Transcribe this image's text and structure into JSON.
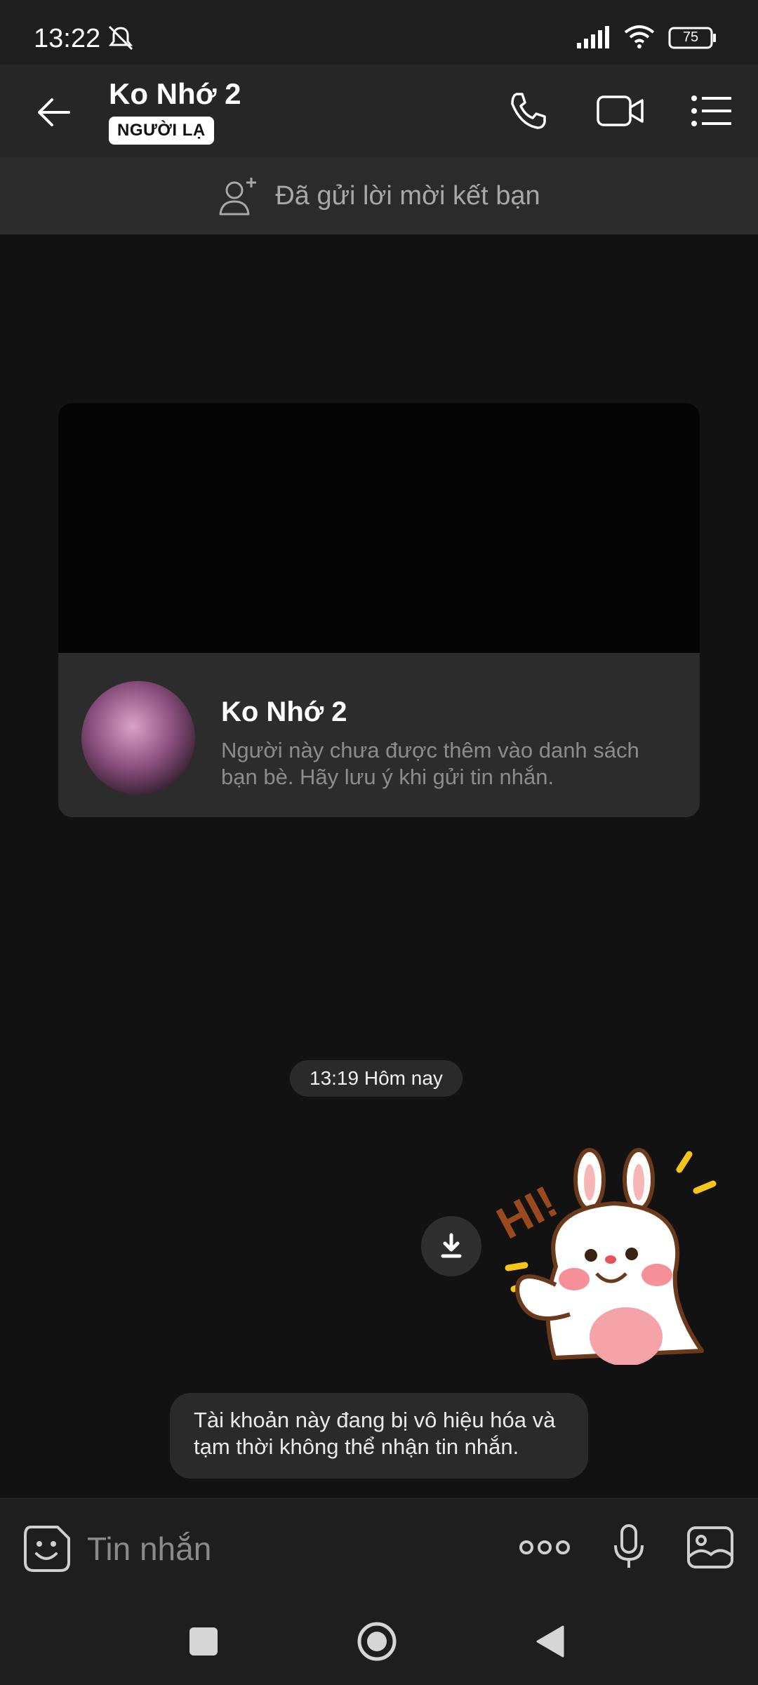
{
  "status_bar": {
    "time": "13:22",
    "battery": "75"
  },
  "header": {
    "title": "Ko Nhớ 2",
    "badge": "NGƯỜI LẠ"
  },
  "friend_banner": {
    "text": "Đã gửi lời mời kết bạn"
  },
  "profile_card": {
    "name": "Ko Nhớ 2",
    "description": "Người này chưa được thêm vào danh sách bạn bè. Hãy lưu ý khi gửi tin nhắn."
  },
  "chat": {
    "timestamp": "13:19 Hôm nay",
    "sticker_text": "HI!",
    "system_message": "Tài khoản này đang bị vô hiệu hóa và tạm thời không thể nhận tin nhắn."
  },
  "input_bar": {
    "placeholder": "Tin nhắn"
  },
  "colors": {
    "background": "#121212",
    "header": "#262626",
    "bubble": "#2a2a2a",
    "muted_text": "#8c8c8c"
  }
}
